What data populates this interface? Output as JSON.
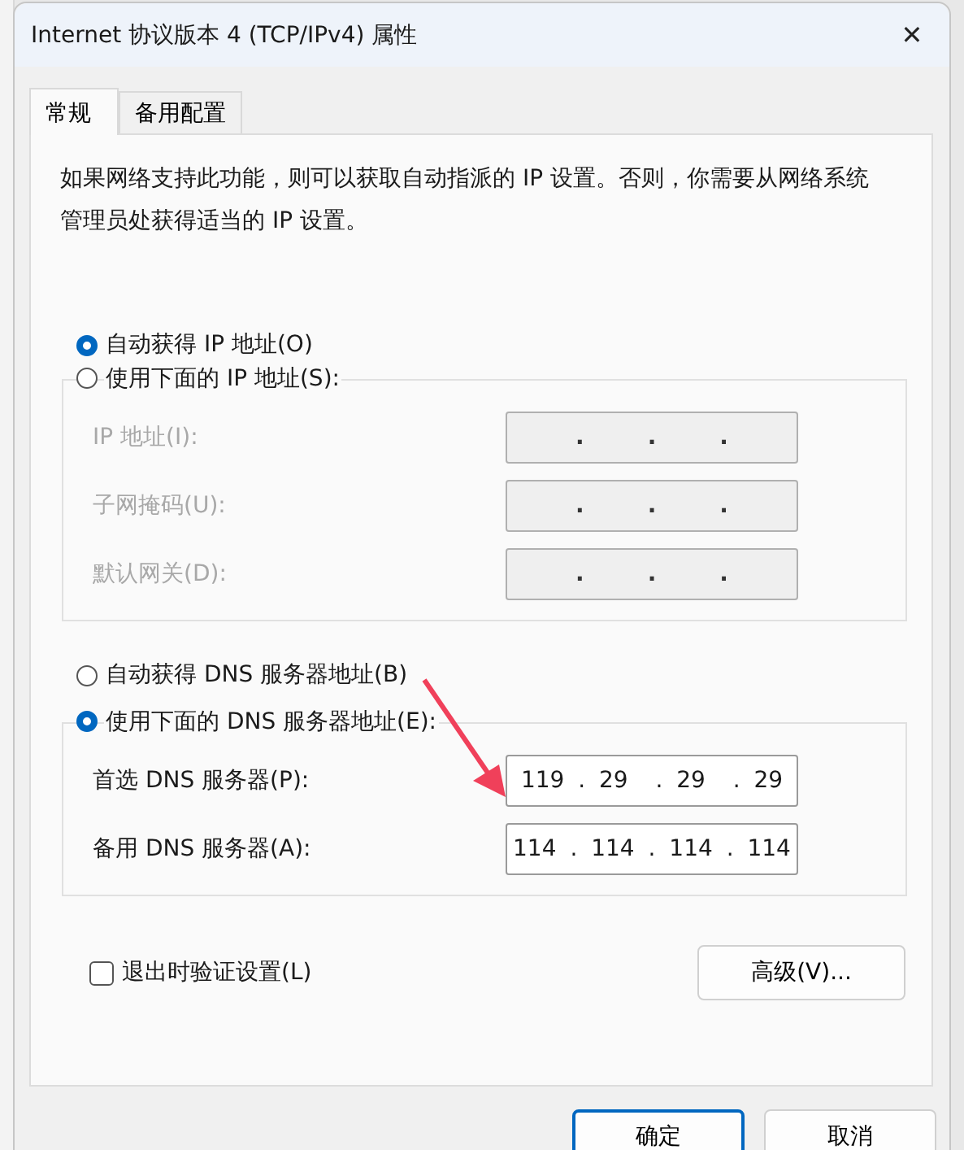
{
  "window": {
    "title": "Internet 协议版本 4 (TCP/IPv4) 属性",
    "close": "✕"
  },
  "tabs": [
    {
      "label": "常规",
      "selected": true
    },
    {
      "label": "备用配置",
      "selected": false
    }
  ],
  "description": "如果网络支持此功能，则可以获取自动指派的 IP 设置。否则，你需要从网络系统管理员处获得适当的 IP 设置。",
  "ip_mode": [
    {
      "label": "自动获得 IP 地址(O)",
      "selected": true
    },
    {
      "label": "使用下面的 IP 地址(S):",
      "selected": false
    }
  ],
  "ip_fields": [
    {
      "label": "IP 地址(I):",
      "value": ".        .        .",
      "disabled": true
    },
    {
      "label": "子网掩码(U):",
      "value": ".        .        .",
      "disabled": true
    },
    {
      "label": "默认网关(D):",
      "value": ".        .        .",
      "disabled": true
    }
  ],
  "dns_mode": [
    {
      "label": "自动获得 DNS 服务器地址(B)",
      "selected": false
    },
    {
      "label": "使用下面的 DNS 服务器地址(E):",
      "selected": true
    }
  ],
  "dns_fields": [
    {
      "label": "首选 DNS 服务器(P):",
      "value": "119 . 29  . 29  . 29",
      "disabled": false
    },
    {
      "label": "备用 DNS 服务器(A):",
      "value": "114 . 114 . 114 . 114",
      "disabled": false
    }
  ],
  "validate": {
    "label": "退出时验证设置(L)",
    "checked": false
  },
  "advanced_button": "高级(V)...",
  "buttons": [
    {
      "label": "确定",
      "default": true
    },
    {
      "label": "取消",
      "default": false
    }
  ]
}
